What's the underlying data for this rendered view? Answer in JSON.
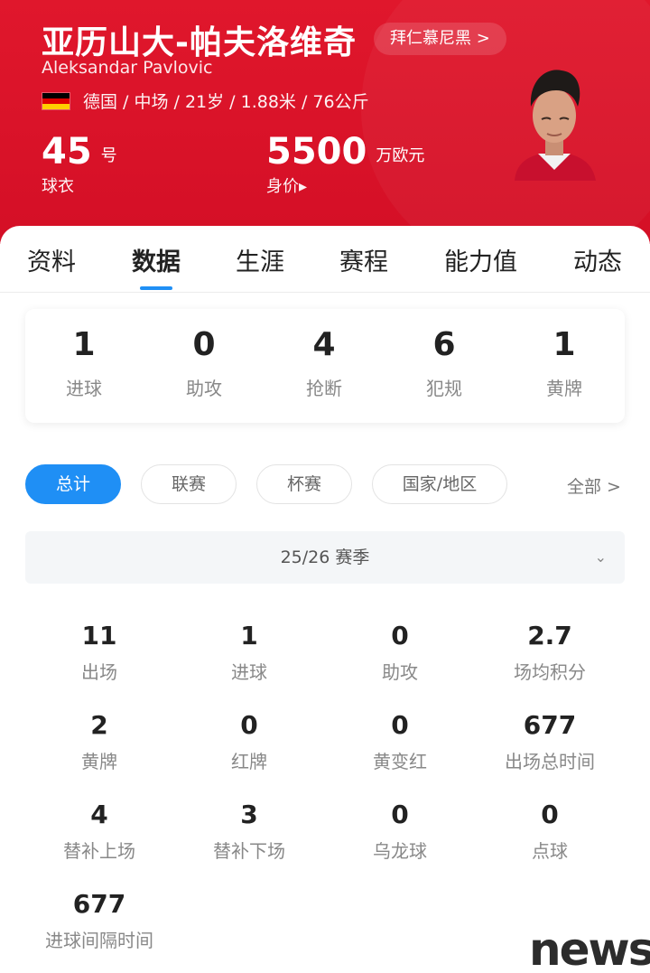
{
  "header": {
    "name_cn": "亚历山大-帕夫洛维奇",
    "team": "拜仁慕尼黑 >",
    "name_en": "Aleksandar Pavlovic",
    "info": "德国 / 中场 / 21岁 / 1.88米 / 76公斤",
    "flag_colors": [
      "#000000",
      "#dd0000",
      "#ffce00"
    ],
    "shirt_number": "45",
    "shirt_unit": "号",
    "shirt_label": "球衣",
    "value": "5500",
    "value_unit": "万欧元",
    "value_label": "身价▸"
  },
  "tabs": [
    "资料",
    "数据",
    "生涯",
    "赛程",
    "能力值",
    "动态"
  ],
  "active_tab": "数据",
  "summary": [
    {
      "value": "1",
      "label": "进球"
    },
    {
      "value": "0",
      "label": "助攻"
    },
    {
      "value": "4",
      "label": "抢断"
    },
    {
      "value": "6",
      "label": "犯规"
    },
    {
      "value": "1",
      "label": "黄牌"
    }
  ],
  "filters": [
    "总计",
    "联赛",
    "杯赛",
    "国家/地区"
  ],
  "filter_all": "全部 >",
  "season": "25/26 赛季",
  "stats": [
    {
      "value": "11",
      "label": "出场"
    },
    {
      "value": "1",
      "label": "进球"
    },
    {
      "value": "0",
      "label": "助攻"
    },
    {
      "value": "2.7",
      "label": "场均积分"
    },
    {
      "value": "2",
      "label": "黄牌"
    },
    {
      "value": "0",
      "label": "红牌"
    },
    {
      "value": "0",
      "label": "黄变红"
    },
    {
      "value": "677",
      "label": "出场总时间"
    },
    {
      "value": "4",
      "label": "替补上场"
    },
    {
      "value": "3",
      "label": "替补下场"
    },
    {
      "value": "0",
      "label": "乌龙球"
    },
    {
      "value": "0",
      "label": "点球"
    },
    {
      "value": "677",
      "label": "进球间隔时间"
    }
  ],
  "watermark": "news",
  "colors": {
    "brand_red": "#d40f26",
    "accent_blue": "#1f8ff5"
  }
}
